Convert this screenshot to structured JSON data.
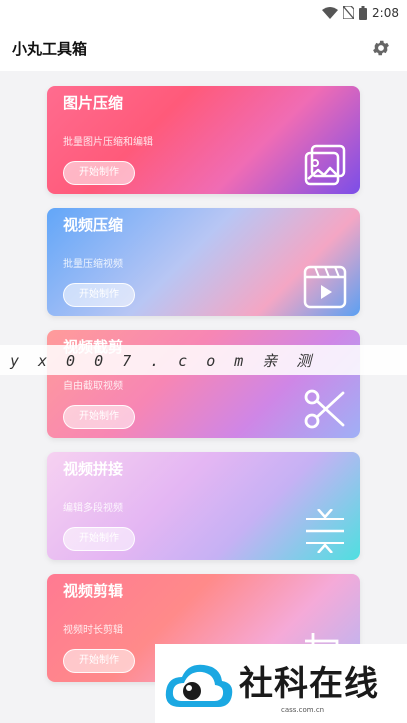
{
  "status": {
    "time": "2:08"
  },
  "app": {
    "title": "小丸工具箱",
    "settings_icon": "gear-icon"
  },
  "cards": [
    {
      "title": "图片压缩",
      "desc": "批量图片压缩和编辑",
      "button": "开始制作",
      "icon": "image-gallery-icon"
    },
    {
      "title": "视频压缩",
      "desc": "批量压缩视频",
      "button": "开始制作",
      "icon": "video-play-icon"
    },
    {
      "title": "视频截剪",
      "desc": "自由截取视频",
      "button": "开始制作",
      "icon": "scissors-icon"
    },
    {
      "title": "视频拼接",
      "desc": "编辑多段视频",
      "button": "开始制作",
      "icon": "merge-arrows-icon"
    },
    {
      "title": "视频剪辑",
      "desc": "视频时长剪辑",
      "button": "开始制作",
      "icon": "crop-icon"
    }
  ],
  "watermark": {
    "text": "yx007.com亲测"
  },
  "logo": {
    "text": "社科在线",
    "url": "cass.com.cn"
  }
}
